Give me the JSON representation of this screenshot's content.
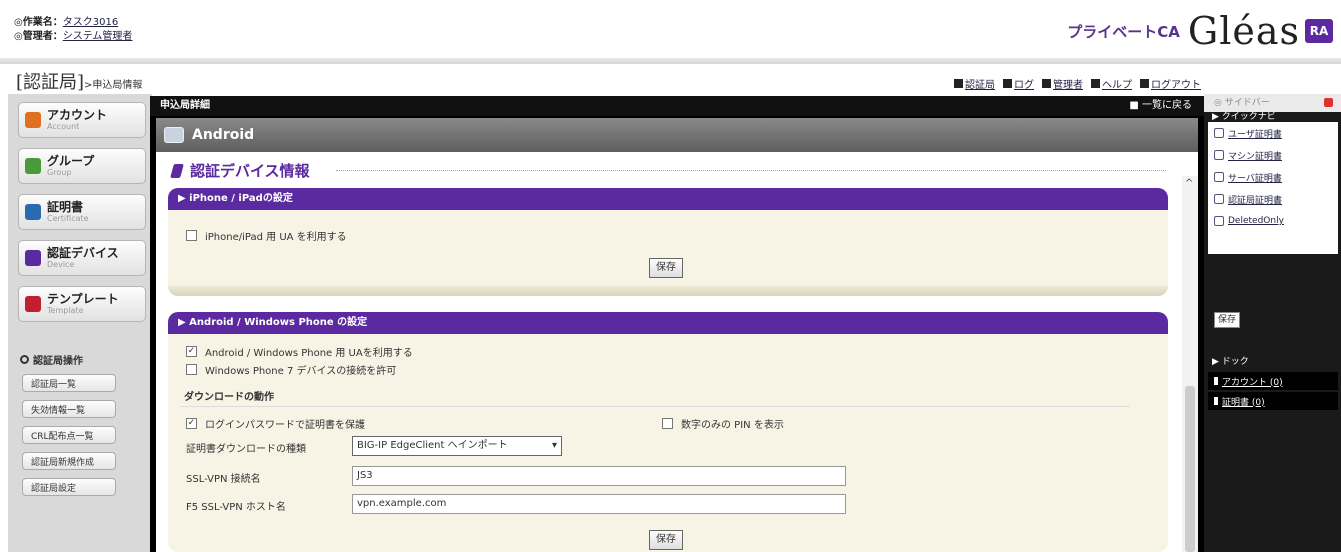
{
  "header": {
    "task_label": "◎作業名：",
    "task_value": "タスク3016",
    "admin_label": "◎管理者：",
    "admin_value": "システム管理者",
    "brand_private_ca": "プライベートCA",
    "brand_logo": "Gléas",
    "brand_badge": "RA",
    "brand_color": "#5b2aa0"
  },
  "breadcrumb": {
    "main": "[認証局]",
    "sub": ">申込局情報"
  },
  "toplinks": [
    "認証局",
    "ログ",
    "管理者",
    "ヘルプ",
    "ログアウト"
  ],
  "leftnav": {
    "items": [
      {
        "label": "アカウント",
        "sub": "Account",
        "icon": "account-icon",
        "color": "#e07020"
      },
      {
        "label": "グループ",
        "sub": "Group",
        "icon": "group-icon",
        "color": "#4a9a3a"
      },
      {
        "label": "証明書",
        "sub": "Certificate",
        "icon": "certificate-icon",
        "color": "#2a6ab0"
      },
      {
        "label": "認証デバイス",
        "sub": "Device",
        "icon": "device-icon",
        "color": "#5b2aa0"
      },
      {
        "label": "テンプレート",
        "sub": "Template",
        "icon": "template-icon",
        "color": "#c02030"
      }
    ],
    "ops_heading": "認証局操作",
    "ops": [
      "認証局一覧",
      "失効情報一覧",
      "CRL配布点一覧",
      "認証局新規作成",
      "認証局設定"
    ]
  },
  "main": {
    "header": "申込局詳細",
    "back_link": "一覧に戻る",
    "title": "Android",
    "section_title": "認証デバイス情報",
    "iphone": {
      "heading": "▶ iPhone / iPadの設定",
      "checkbox_label": "iPhone/iPad 用 UA を利用する",
      "checked": false,
      "save": "保存"
    },
    "android": {
      "heading": "▶ Android / Windows Phone の設定",
      "cb1_label": "Android / Windows Phone 用 UAを利用する",
      "cb1_checked": true,
      "cb2_label": "Windows Phone 7 デバイスの接続を許可",
      "cb2_checked": false,
      "download_heading": "ダウンロードの動作",
      "cb3_label": "ログインパスワードで証明書を保護",
      "cb3_checked": true,
      "cb4_label": "数字のみの PIN を表示",
      "cb4_checked": false,
      "type_label": "証明書ダウンロードの種類",
      "type_value": "BIG-IP EdgeClient へインポート",
      "sslvpn_label": "SSL-VPN 接続名",
      "sslvpn_value": "JS3",
      "f5_label": "F5 SSL-VPN ホスト名",
      "f5_value": "vpn.example.com",
      "save": "保存"
    }
  },
  "sidebar": {
    "title": "サイドバー",
    "quicknav_heading": "▶ クイックナビ",
    "quicknav": [
      {
        "label": "ユーザ証明書",
        "icon": "user-cert-icon"
      },
      {
        "label": "マシン証明書",
        "icon": "machine-cert-icon"
      },
      {
        "label": "サーバ証明書",
        "icon": "server-cert-icon"
      },
      {
        "label": "認証局証明書",
        "icon": "ca-cert-icon"
      },
      {
        "label": "DeletedOnly",
        "icon": "folder-icon"
      }
    ],
    "save": "保存",
    "dock_heading": "▶ ドック",
    "dock": [
      "アカウント (0)",
      "証明書 (0)"
    ]
  }
}
